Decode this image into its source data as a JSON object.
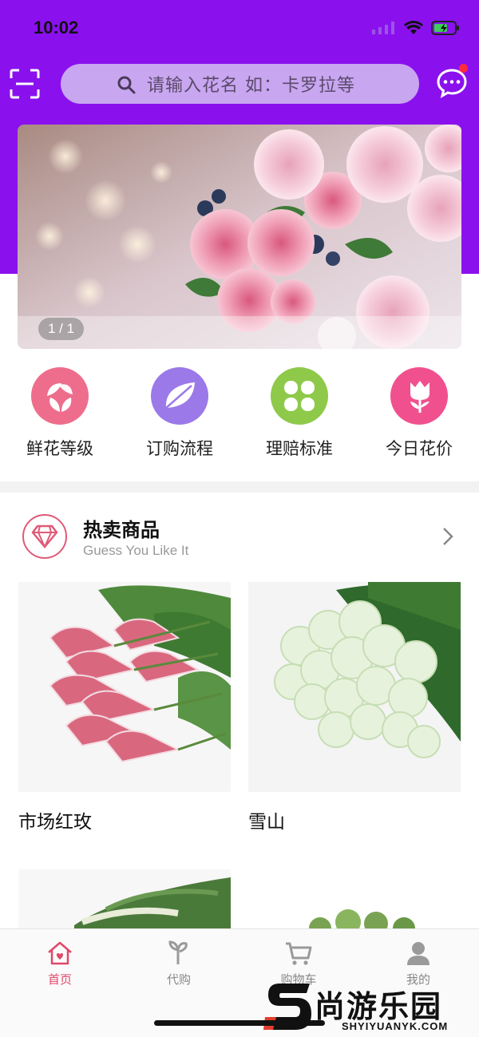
{
  "status_bar": {
    "time": "10:02"
  },
  "header": {
    "search_placeholder": "请输入花名 如：卡罗拉等"
  },
  "banner": {
    "indicator": "1 / 1"
  },
  "categories": [
    {
      "label": "鲜花等级",
      "icon": "leaves-icon",
      "color": "#ee6d8c"
    },
    {
      "label": "订购流程",
      "icon": "leaf-icon",
      "color": "#9b79e8"
    },
    {
      "label": "理赔标准",
      "icon": "clover-icon",
      "color": "#8ec94a"
    },
    {
      "label": "今日花价",
      "icon": "tulip-icon",
      "color": "#f0518e"
    }
  ],
  "hot": {
    "title": "热卖商品",
    "subtitle": "Guess You Like It"
  },
  "products": [
    {
      "name": "市场红玫"
    },
    {
      "name": "雪山"
    }
  ],
  "tabbar": {
    "items": [
      {
        "label": "首页",
        "icon": "home-icon",
        "active": true
      },
      {
        "label": "代购",
        "icon": "flower-icon",
        "active": false
      },
      {
        "label": "购物车",
        "icon": "cart-icon",
        "active": false
      },
      {
        "label": "我的",
        "icon": "user-icon",
        "active": false
      }
    ]
  },
  "watermark": {
    "text": "尚游乐园",
    "url": "SHYIYUANYK.COM"
  },
  "colors": {
    "brand_purple": "#8a11ee",
    "accent_pink": "#e0486a",
    "search_bg": "#c8a6f0"
  }
}
